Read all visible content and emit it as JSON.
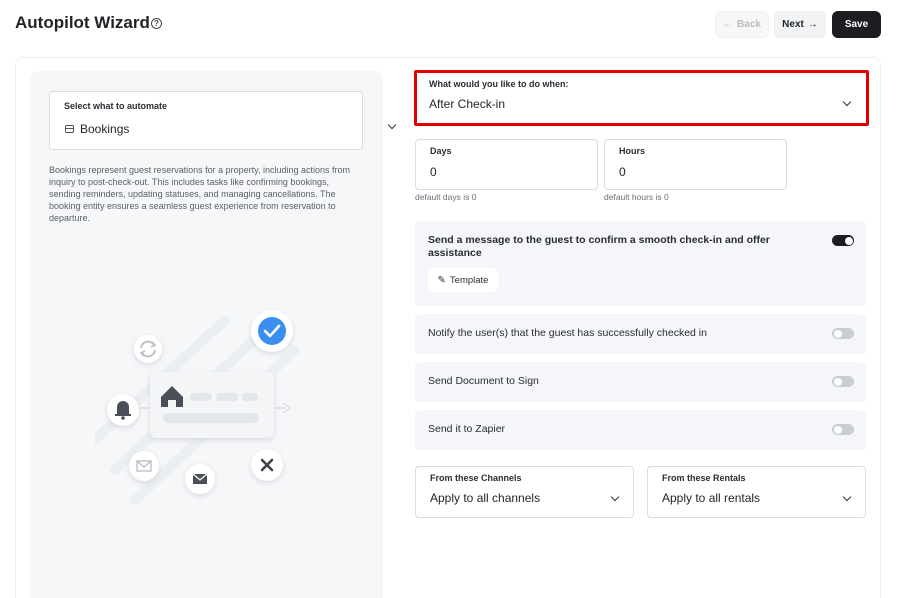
{
  "header": {
    "title": "Autopilot Wizard",
    "help_icon": "question-circle-icon",
    "back_label": "Back",
    "next_label": "Next",
    "save_label": "Save"
  },
  "automate": {
    "label": "Select what to automate",
    "value": "Bookings",
    "icon": "calendar-icon",
    "description": "Bookings represent guest reservations for a property, including actions from inquiry to post-check-out. This includes tasks like confirming bookings, sending reminders, updating statuses, and managing cancellations. The booking entity ensures a seamless guest experience from reservation to departure."
  },
  "trigger": {
    "label": "What would you like to do when:",
    "value": "After Check-in",
    "highlight_color": "#e00000"
  },
  "days": {
    "label": "Days",
    "value": "0",
    "hint": "default days is 0"
  },
  "hours": {
    "label": "Hours",
    "value": "0",
    "hint": "default hours is 0"
  },
  "actions": [
    {
      "text": "Send a message to the guest to confirm a smooth check-in and offer assistance",
      "enabled": true,
      "template_label": "Template"
    },
    {
      "text": "Notify the user(s) that the guest has successfully checked in",
      "enabled": false
    },
    {
      "text": "Send Document to Sign",
      "enabled": false
    },
    {
      "text": "Send it to Zapier",
      "enabled": false
    }
  ],
  "channels": {
    "label": "From these Channels",
    "value": "Apply to all channels"
  },
  "rentals": {
    "label": "From these Rentals",
    "value": "Apply to all rentals"
  },
  "colors": {
    "primary": "#1c1d20",
    "card_bg": "#f4f6f9",
    "check_blue": "#3b8ff0"
  }
}
